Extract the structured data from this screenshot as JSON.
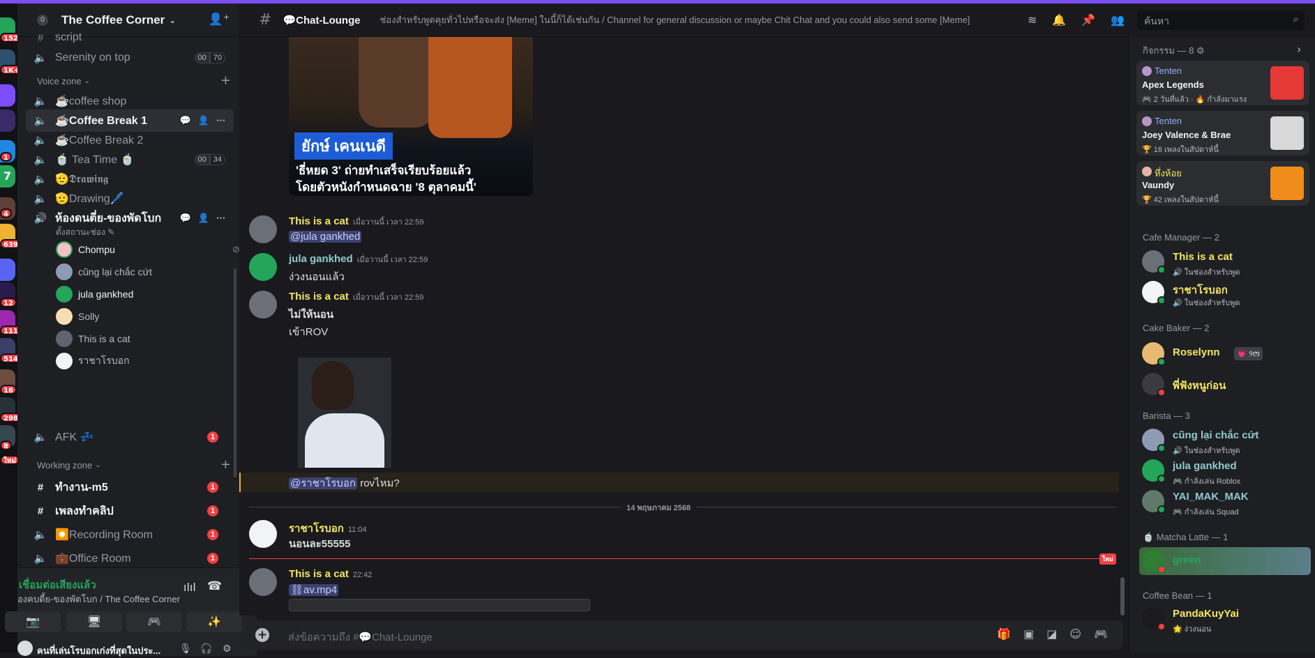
{
  "colors": {
    "accent": "#7c4dff",
    "online": "#23a55a",
    "dnd": "#f23f43",
    "mention": "#c9cdfb"
  },
  "rail": {
    "badges": [
      "152",
      "1K+",
      "1",
      "7",
      "4",
      "639",
      "12",
      "111",
      "514",
      "16",
      "298",
      "8",
      "ใหม่"
    ]
  },
  "server": {
    "name": "The Coffee Corner",
    "count": "0"
  },
  "channels": {
    "script": "script",
    "serenity": {
      "label": "Serenity on top",
      "users": "00",
      "limit": "70"
    },
    "voice_cat": "Voice zone",
    "coffee_shop": "☕coffee shop",
    "coffee_break1": "☕Coffee Break 1",
    "coffee_break2": "☕Coffee Break 2",
    "tea_time": {
      "label": "🍵 Tea Time 🍵",
      "users": "00",
      "limit": "34"
    },
    "drawing1": "🫡𝕯𝖗𝖆𝖜𝖎𝖓𝖌",
    "drawing2": "🫡Drawing🖊️",
    "listen_room": {
      "label": "ห้องดนตี่ย-ของพัดโบก",
      "status": "ตั้งสถานะช่อง"
    },
    "voice_users": [
      "Chompu",
      "cũng lại chắc cứt",
      "jula gankhed",
      "Solly",
      "This is a cat",
      "ราชาโรบอก"
    ],
    "afk": {
      "label": "AFK 💤",
      "badge": "1"
    },
    "working_cat": "Working zone",
    "work_m5": {
      "label": "ทำงาน-m5",
      "badge": "1"
    },
    "song_clip": {
      "label": "เพลงทำคลิป",
      "badge": "1"
    },
    "recording": {
      "label": "⏺️Recording Room",
      "badge": "1"
    },
    "office": {
      "label": "💼Office Room",
      "badge": "1"
    }
  },
  "voice_panel": {
    "connected": "เชื่อมต่อเสียงแล้ว",
    "channel": "องคบดี้ย-ของพัดโบก / The Coffee Corner",
    "user": "คนที่เล่นโรบอกเก่งที่สุดในประ..."
  },
  "chat": {
    "channel": "💬Chat-Lounge",
    "topic": "ช่องสำหรับพูดคุยทั่วไปหรือจะส่ง [Meme] ในนี้ก็ได้เช่นกัน / Channel for general discussion or maybe Chit Chat and you could also send some [Meme]",
    "search_placeholder": "ค้นหา",
    "poster": {
      "name": "ยักษ์ เคนเนดี",
      "line1": "'ธี่หยด 3' ถ่ายทำเสร็จเรียบร้อยแล้ว",
      "line2": "โดยตัวหนังกำหนดฉาย '8 ตุลาคมนี้'"
    },
    "messages": [
      {
        "author": "This is a cat",
        "time": "เมื่อวานนี้ เวลา 22:59",
        "text": "@jula gankhed"
      },
      {
        "author": "jula gankhed",
        "time": "เมื่อวานนี้ เวลา 22:59",
        "text": "ง่วงนอนแล้ว"
      },
      {
        "author": "This is a cat",
        "time": "เมื่อวานนี้ เวลา 22:59",
        "text1": "ไม่ให้นอน",
        "text2": "เข้าROV"
      },
      {
        "reply_mention": "@ราชาโรบอก",
        "reply_text": " rovไหม?"
      },
      {
        "author": "ราชาโรบอก",
        "time": "11:04",
        "text": "นอนละ55555"
      },
      {
        "author": "This is a cat",
        "time": "22:42",
        "text": "av.mp4"
      }
    ],
    "date_divider": "14 พฤษภาคม 2568",
    "new_label": "ใหม่",
    "composer_placeholder": "ส่งข้อความถึง #💬Chat-Lounge"
  },
  "members": {
    "activity_header": "กิจกรรม — 8",
    "activities": [
      {
        "user": "Tenten",
        "title": "Apex Legends",
        "sub": "🎮 2 วันที่แล้ว · 🔥 กำลังมาแรง"
      },
      {
        "user": "Tenten",
        "title": "Joey Valence & Brae",
        "sub": "🏆 16 เพลงในสัปดาห์นี้"
      },
      {
        "user": "หึ่งห้อย",
        "title": "Vaundy",
        "sub": "🏆 42 เพลงในสัปดาห์นี้"
      }
    ],
    "groups": [
      {
        "label": "Cafe Manager — 2",
        "members": [
          {
            "name": "This is a cat",
            "sub": "🔊 ในช่องสำหรับพูด"
          },
          {
            "name": "ราชาโรบอก",
            "sub": "🔊 ในช่องสำหรับพูด"
          }
        ]
      },
      {
        "label": "Cake Baker — 2",
        "members": [
          {
            "name": "Roselynn",
            "tag": "💗 ୨ᰔ"
          },
          {
            "name": "พี่ฟังหนูก่อน"
          }
        ]
      },
      {
        "label": "Barista — 3",
        "members": [
          {
            "name": "cũng lại chắc cứt",
            "sub": "🔊 ในช่องสำหรับพูด"
          },
          {
            "name": "jula gankhed",
            "sub": "🎮 กำลังเล่น Roblox"
          },
          {
            "name": "YAI_MAK_MAK",
            "sub": "🎮 กำลังเล่น Squad"
          }
        ]
      },
      {
        "label": "🍵 Matcha Latte — 1",
        "members": [
          {
            "name": "green"
          }
        ]
      },
      {
        "label": "Coffee Bean — 1",
        "members": [
          {
            "name": "PandaKuyYai",
            "sub": "🌟 ง่วงนอน"
          }
        ]
      }
    ]
  }
}
